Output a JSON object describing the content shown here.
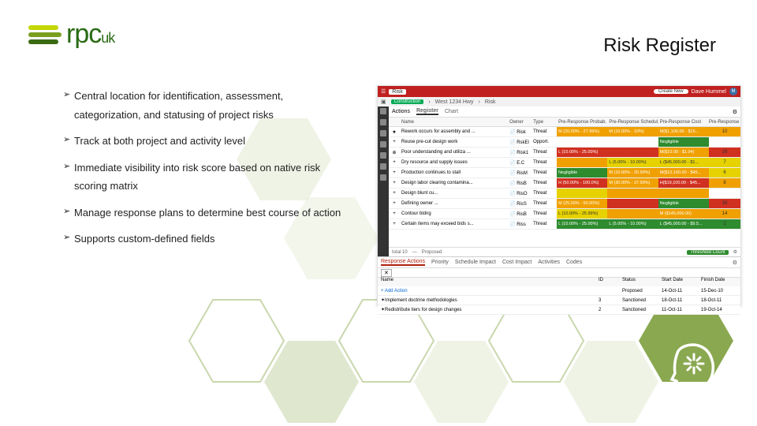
{
  "logo": {
    "text": "rpc",
    "suffix": "uk"
  },
  "title": "Risk Register",
  "bullets": [
    {
      "line1": "Central location for identification, assessment,",
      "line2": "categorization, and statusing of project risks"
    },
    {
      "line1": "Track at both project and activity level"
    },
    {
      "line1": "Immediate visibility into risk score based on native risk",
      "line2": "scoring matrix"
    },
    {
      "line1": "Manage response plans to determine best course of action"
    },
    {
      "line1": "Supports custom-defined fields"
    }
  ],
  "app": {
    "brand_icon": "menu",
    "module": "Risk",
    "create": "Create New",
    "user": "Dave Hummel",
    "user_initials": "M",
    "breadcrumb": {
      "p1": "Construction",
      "p2": "West 1234 Hwy",
      "p3": "Risk"
    },
    "toolbar": {
      "actions": "Actions",
      "tabs": [
        "Register",
        "Chart"
      ]
    },
    "columns": {
      "name": "Name",
      "owner": "Owner",
      "type": "Type",
      "prob": "Pre-Response Probab.",
      "sched": "Pre-Response Schedul.",
      "cost": "Pre-Response Cost",
      "score": "Pre-Response Score"
    },
    "rows": [
      {
        "name": "Rework occurs for assembly and ...",
        "owner": "Risk",
        "type": "Threat",
        "prob": {
          "t": "M (20.00% - 27.99%)",
          "c": "med"
        },
        "sched": {
          "t": "M (10.00% - 10%)",
          "c": "med"
        },
        "cost": {
          "t": "M($1,100.00 - $15...",
          "c": "med"
        },
        "score": {
          "v": "10",
          "c": "med"
        }
      },
      {
        "name": "Reuse pre-cut design work",
        "owner": "RskEl",
        "type": "Opport.",
        "prob": {
          "t": "",
          "c": ""
        },
        "sched": {
          "t": "",
          "c": ""
        },
        "cost": {
          "t": "Negligible",
          "c": "neg"
        },
        "score": {
          "v": "",
          "c": ""
        }
      },
      {
        "name": "Poor understanding and utiliza ...",
        "owner": "Risk1",
        "type": "Threat",
        "prob": {
          "t": "L (10.00% - 25.00%)",
          "c": "high"
        },
        "sched": {
          "t": "",
          "c": "high"
        },
        "cost": {
          "t": "M($10.00 - $1.04)",
          "c": "med"
        },
        "score": {
          "v": "28",
          "c": "high"
        }
      },
      {
        "name": "Dry resource and supply issues",
        "owner": "E.C",
        "type": "Threat",
        "prob": {
          "t": "",
          "c": "med"
        },
        "sched": {
          "t": "L (5.00% - 10.00%)",
          "c": "low"
        },
        "cost": {
          "t": "L ($45,000.00 - $1...",
          "c": "low"
        },
        "score": {
          "v": "7",
          "c": "low"
        }
      },
      {
        "name": "Production continues to stall",
        "owner": "RisM",
        "type": "Threat",
        "prob": {
          "t": "Negligible",
          "c": "neg"
        },
        "sched": {
          "t": "M (10.00% - 20.99%)",
          "c": "med"
        },
        "cost": {
          "t": "M($10,100.00 - $45...",
          "c": "med"
        },
        "score": {
          "v": "6",
          "c": "low"
        }
      },
      {
        "name": "Design labor clearing contamina...",
        "owner": "RisB",
        "type": "Threat",
        "prob": {
          "t": "H (50.00% - 100.0%)",
          "c": "high"
        },
        "sched": {
          "t": "M (30.00% - 37.99%)",
          "c": "med"
        },
        "cost": {
          "t": "H($19,100.00 - $45...",
          "c": "high"
        },
        "score": {
          "v": "8",
          "c": "med"
        }
      },
      {
        "name": "Design blunt cu...",
        "owner": "RisO",
        "type": "Threat",
        "prob": {
          "t": "",
          "c": "low"
        },
        "sched": {
          "t": "",
          "c": "med"
        },
        "cost": {
          "t": "",
          "c": "med"
        },
        "score": {
          "v": "",
          "c": ""
        }
      },
      {
        "name": "Defining owner ...",
        "owner": "RisS",
        "type": "Threat",
        "prob": {
          "t": "M (25.00% - 50.00%)",
          "c": "med"
        },
        "sched": {
          "t": "",
          "c": "high"
        },
        "cost": {
          "t": "Negligible",
          "c": "neg"
        },
        "score": {
          "v": "38",
          "c": "high"
        }
      },
      {
        "name": "Contour bldng",
        "owner": "RisB",
        "type": "Threat",
        "prob": {
          "t": "L (10.00% - 25.99%)",
          "c": "low"
        },
        "sched": {
          "t": "",
          "c": "med"
        },
        "cost": {
          "t": "M ($145,000.00)",
          "c": "med"
        },
        "score": {
          "v": "14",
          "c": "med"
        }
      },
      {
        "name": "Certain items may exceed bids s...",
        "owner": "Riss",
        "type": "Threat",
        "prob": {
          "t": "L (10.00% - 25.00%)",
          "c": "neg"
        },
        "sched": {
          "t": "L (5.00% - 10.00%)",
          "c": "neg"
        },
        "cost": {
          "t": "L ($45,000.00 - $9.5...",
          "c": "neg"
        },
        "score": {
          "v": "2",
          "c": "neg"
        }
      }
    ],
    "footer": {
      "count_label": "total 10",
      "proposed": "Proposed",
      "threshold": "Threshold Count"
    },
    "bottom": {
      "tabs": [
        "Response Actions",
        "Priority",
        "Schedule Impact",
        "Cost Impact",
        "Activities",
        "Codes"
      ],
      "columns": {
        "name": "Name",
        "id": "ID",
        "status": "Status",
        "start": "Start Date",
        "finish": "Finish Date"
      },
      "add": "+ Add Action",
      "rows": [
        {
          "name": "",
          "id": "",
          "status": "Proposed",
          "start": "14-Oct-11",
          "finish": "15-Dec-10"
        },
        {
          "name": "Implement doctrine methodologies",
          "id": "3",
          "status": "Sanctioned",
          "start": "18-Oct-11",
          "finish": "18-Oct-11"
        },
        {
          "name": "Redistribute tiers for design changes",
          "id": "2",
          "status": "Sanctioned",
          "start": "11-Oct-11",
          "finish": "19-Oct-14"
        }
      ]
    }
  }
}
